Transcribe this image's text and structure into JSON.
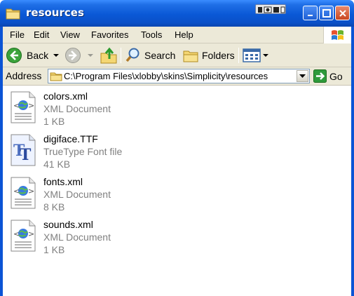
{
  "window": {
    "title": "resources"
  },
  "menu": [
    "File",
    "Edit",
    "View",
    "Favorites",
    "Tools",
    "Help"
  ],
  "toolbar": {
    "back": "Back",
    "search": "Search",
    "folders": "Folders"
  },
  "address": {
    "label": "Address",
    "path": "C:\\Program Files\\xlobby\\skins\\Simplicity\\resources",
    "go": "Go"
  },
  "files": [
    {
      "name": "colors.xml",
      "type": "XML Document",
      "size": "1 KB",
      "icon": "xml-document-icon"
    },
    {
      "name": "digiface.TTF",
      "type": "TrueType Font file",
      "size": "41 KB",
      "icon": "truetype-font-icon"
    },
    {
      "name": "fonts.xml",
      "type": "XML Document",
      "size": "8 KB",
      "icon": "xml-document-icon"
    },
    {
      "name": "sounds.xml",
      "type": "XML Document",
      "size": "1 KB",
      "icon": "xml-document-icon"
    }
  ],
  "colors": {
    "titlebar": "#0a58d6",
    "chrome": "#ece9d8",
    "secondary_text": "#808080"
  }
}
